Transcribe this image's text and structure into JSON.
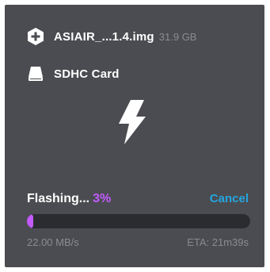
{
  "image": {
    "name": "ASIAIR_...1.4.img",
    "size": "31.9 GB",
    "icon": "plus-circle-icon"
  },
  "drive": {
    "name": "SDHC Card",
    "icon": "drive-icon"
  },
  "status_icon": "lightning-bolt-icon",
  "progress": {
    "status_label": "Flashing...",
    "percent_label": "3%",
    "percent": 3,
    "speed": "22.00 MB/s",
    "eta": "ETA: 21m39s"
  },
  "cancel_label": "Cancel",
  "colors": {
    "panel_bg": "#4b4c51",
    "accent": "#c35bff",
    "link": "#23a6e0",
    "muted": "#8a8b90"
  }
}
